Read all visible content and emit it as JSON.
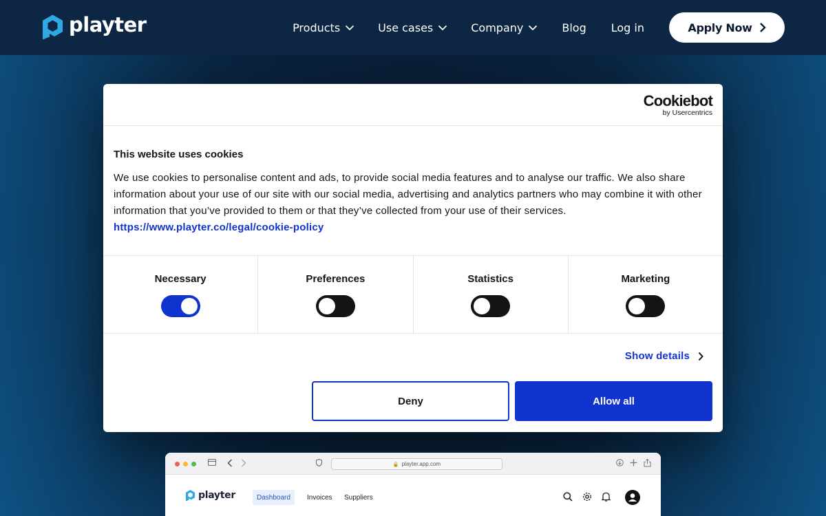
{
  "header": {
    "logo_text": "playter",
    "nav": {
      "products": "Products",
      "use_cases": "Use cases",
      "company": "Company",
      "blog": "Blog",
      "login": "Log in"
    },
    "apply_button": "Apply Now"
  },
  "cookie_dialog": {
    "brand_name": "Cookiebot",
    "brand_sub": "by Usercentrics",
    "title": "This website uses cookies",
    "description": "We use cookies to personalise content and ads, to provide social media features and to analyse our traffic. We also share information about your use of our site with our social media, advertising and analytics partners who may combine it with other information that you’ve provided to them or that they’ve collected from your use of their services.",
    "policy_link": "https://www.playter.co/legal/cookie-policy",
    "categories": [
      {
        "label": "Necessary",
        "enabled": true
      },
      {
        "label": "Preferences",
        "enabled": false
      },
      {
        "label": "Statistics",
        "enabled": false
      },
      {
        "label": "Marketing",
        "enabled": false
      }
    ],
    "show_details": "Show details",
    "deny_button": "Deny",
    "allow_button": "Allow all"
  },
  "preview": {
    "url": "playter.app.com",
    "logo_text": "playter",
    "tabs": [
      "Dashboard",
      "Invoices",
      "Suppliers"
    ],
    "active_tab": "Dashboard"
  },
  "colors": {
    "header_bg": "#0c2643",
    "accent_blue": "#1032cf",
    "logo_blue": "#2fa8e4"
  }
}
